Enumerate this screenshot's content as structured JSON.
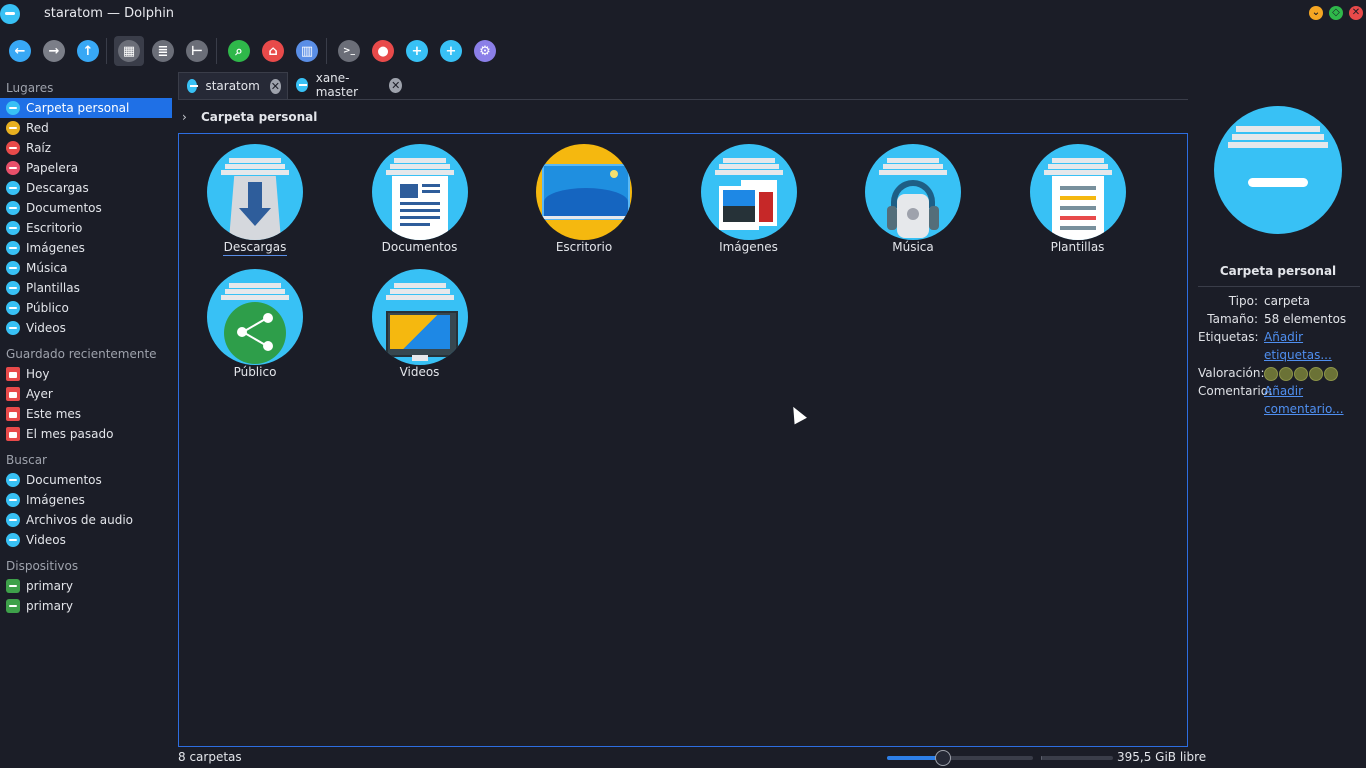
{
  "window": {
    "title": "staratom — Dolphin"
  },
  "toolbar": {
    "buttons": [
      {
        "name": "back",
        "icon": "arrow-left-icon"
      },
      {
        "name": "forward",
        "icon": "arrow-right-icon"
      },
      {
        "name": "up",
        "icon": "arrow-up-icon"
      },
      {
        "name": "icons-view",
        "icon": "grid-view-icon",
        "active": true
      },
      {
        "name": "details-view",
        "icon": "list-view-icon"
      },
      {
        "name": "tree-view",
        "icon": "tree-view-icon"
      },
      {
        "name": "search",
        "icon": "search-icon"
      },
      {
        "name": "home",
        "icon": "home-icon"
      },
      {
        "name": "split-view",
        "icon": "split-view-icon"
      },
      {
        "name": "terminal",
        "icon": "terminal-icon",
        "glyph": ">_"
      },
      {
        "name": "record",
        "icon": "record-icon"
      },
      {
        "name": "new-folder",
        "icon": "new-folder-icon"
      },
      {
        "name": "new-tab",
        "icon": "plus-icon",
        "glyph": "+"
      },
      {
        "name": "settings",
        "icon": "gear-icon",
        "glyph": "⚙"
      }
    ]
  },
  "sidebar": {
    "sections": [
      {
        "title": "Lugares",
        "items": [
          {
            "label": "Carpeta personal",
            "selected": true,
            "color": "#38c1f5"
          },
          {
            "label": "Red",
            "color": "#e8b020"
          },
          {
            "label": "Raíz",
            "color": "#e84a4a"
          },
          {
            "label": "Papelera",
            "color": "#e8506a"
          },
          {
            "label": "Descargas",
            "color": "#38c1f5"
          },
          {
            "label": "Documentos",
            "color": "#38c1f5"
          },
          {
            "label": "Escritorio",
            "color": "#38c1f5"
          },
          {
            "label": "Imágenes",
            "color": "#38c1f5"
          },
          {
            "label": "Música",
            "color": "#38c1f5"
          },
          {
            "label": "Plantillas",
            "color": "#38c1f5"
          },
          {
            "label": "Público",
            "color": "#38c1f5"
          },
          {
            "label": "Videos",
            "color": "#38c1f5"
          }
        ]
      },
      {
        "title": "Guardado recientemente",
        "items": [
          {
            "label": "Hoy",
            "type": "cal"
          },
          {
            "label": "Ayer",
            "type": "cal"
          },
          {
            "label": "Este mes",
            "type": "cal"
          },
          {
            "label": "El mes pasado",
            "type": "cal"
          }
        ]
      },
      {
        "title": "Buscar",
        "items": [
          {
            "label": "Documentos",
            "color": "#38c1f5"
          },
          {
            "label": "Imágenes",
            "color": "#38c1f5"
          },
          {
            "label": "Archivos de audio",
            "color": "#38c1f5"
          },
          {
            "label": "Videos",
            "color": "#38c1f5"
          }
        ]
      },
      {
        "title": "Dispositivos",
        "items": [
          {
            "label": "primary",
            "type": "dev"
          },
          {
            "label": "primary",
            "type": "dev"
          }
        ]
      }
    ]
  },
  "tabs": [
    {
      "label": "staratom",
      "active": true
    },
    {
      "label": "xane-master",
      "active": false
    }
  ],
  "breadcrumb": {
    "current": "Carpeta personal"
  },
  "files": [
    {
      "label": "Descargas",
      "kind": "downloads",
      "focused": true
    },
    {
      "label": "Documentos",
      "kind": "documents"
    },
    {
      "label": "Escritorio",
      "kind": "desktop"
    },
    {
      "label": "Imágenes",
      "kind": "pictures"
    },
    {
      "label": "Música",
      "kind": "music"
    },
    {
      "label": "Plantillas",
      "kind": "templates"
    },
    {
      "label": "Público",
      "kind": "public"
    },
    {
      "label": "Videos",
      "kind": "videos"
    }
  ],
  "info_panel": {
    "title": "Carpeta personal",
    "rows": [
      {
        "key": "Tipo:",
        "value": "carpeta"
      },
      {
        "key": "Tamaño:",
        "value": "58 elementos"
      },
      {
        "key": "Etiquetas:",
        "value": "Añadir etiquetas...",
        "link": true
      },
      {
        "key": "Valoración:",
        "value": "",
        "stars": 5
      },
      {
        "key": "Comentario:",
        "value": "Añadir comentario...",
        "link": true
      }
    ]
  },
  "status": {
    "folders": "8 carpetas",
    "free": "395,5 GiB libre",
    "zoom_fraction": 0.38,
    "disk_used_fraction": 0.02
  },
  "colors": {
    "accent": "#1f70e6",
    "folder": "#38c1f5",
    "desktop_folder": "#f5b80f"
  }
}
